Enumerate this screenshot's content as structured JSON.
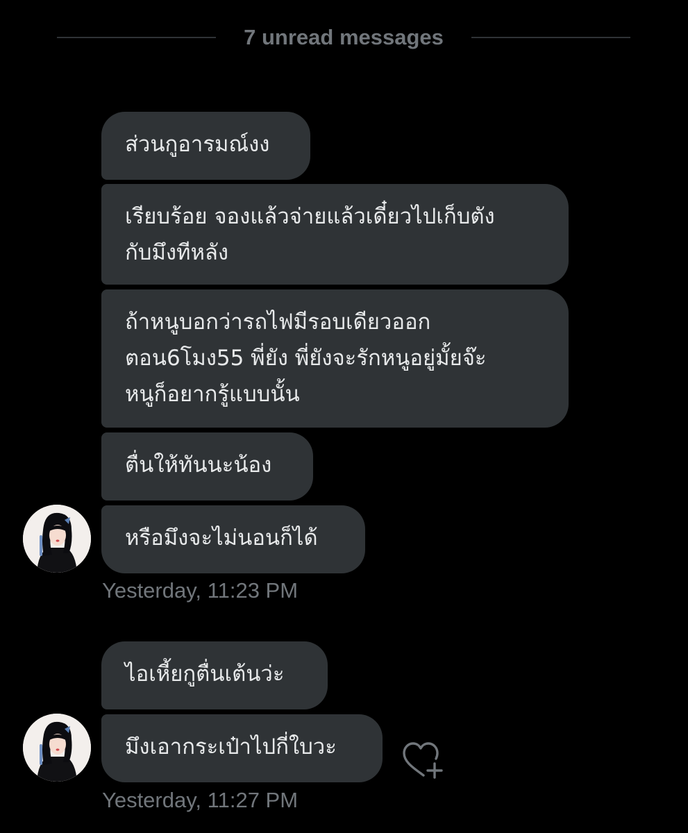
{
  "divider": {
    "label": "7 unread messages"
  },
  "group1": {
    "messages": [
      "ส่วนกูอารมณ์งง",
      "เรียบร้อย จองแล้วจ่ายแล้วเดี๋ยวไปเก็บตัง\nกับมึงทีหลัง",
      "ถ้าหนูบอกว่ารถไฟมีรอบเดียวออก\nตอน6โมง55 พี่ยัง พี่ยังจะรักหนูอยู่มั้ยจ๊ะ\nหนูก็อยากรู้แบบนั้น",
      "ตื่นให้ทันนะน้อง",
      "หรือมึงจะไม่นอนก็ได้"
    ],
    "timestamp": "Yesterday, 11:23 PM"
  },
  "group2": {
    "messages": [
      "ไอเหี้ยกูตื่นเต้นว่ะ",
      "มึงเอากระเป๋าไปกี่ใบวะ"
    ],
    "timestamp": "Yesterday, 11:27 PM"
  },
  "icons": {
    "avatar": "user-avatar",
    "react": "heart-plus-icon"
  },
  "colors": {
    "background": "#000000",
    "bubble": "#2f3336",
    "text": "#e7e9ea",
    "muted": "#71767b"
  }
}
